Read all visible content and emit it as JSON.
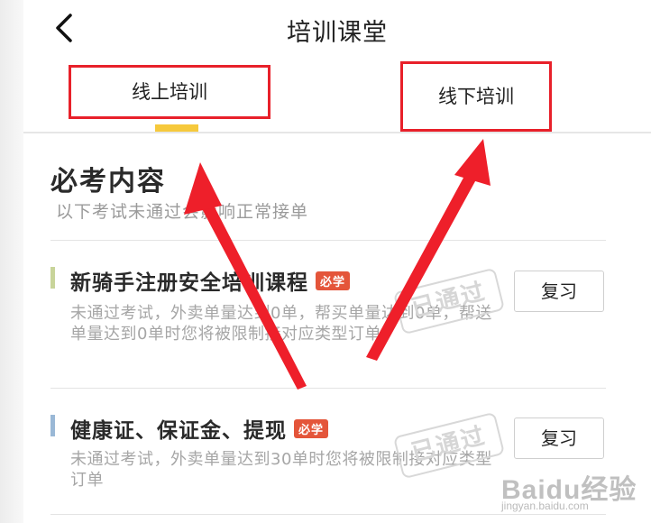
{
  "header": {
    "title": "培训课堂",
    "back_icon": "chevron-left-icon"
  },
  "tabs": [
    {
      "label": "线上培训",
      "active": true
    },
    {
      "label": "线下培训",
      "active": false
    }
  ],
  "section": {
    "title": "必考内容",
    "subtitle": "以下考试未通过会影响正常接单"
  },
  "courses": [
    {
      "title": "新骑手注册安全培训课程",
      "badge": "必学",
      "description": "未通过考试，外卖单量达到0单，帮买单量达到0单，帮送单量达到0单时您将被限制接对应类型订单",
      "stamp": "已通过",
      "button": "复习",
      "bar_color": "#c8d49a"
    },
    {
      "title": "健康证、保证金、提现",
      "badge": "必学",
      "description": "未通过考试，外卖单量达到30单时您将被限制接对应类型订单",
      "stamp": "已通过",
      "button": "复习",
      "bar_color": "#9ab8d6"
    }
  ],
  "colors": {
    "accent": "#f6c93c",
    "badge": "#e4553a",
    "annotation": "#e8202a"
  },
  "watermark": {
    "brand": "Baidu经验",
    "url": "jingyan.baidu.com"
  }
}
